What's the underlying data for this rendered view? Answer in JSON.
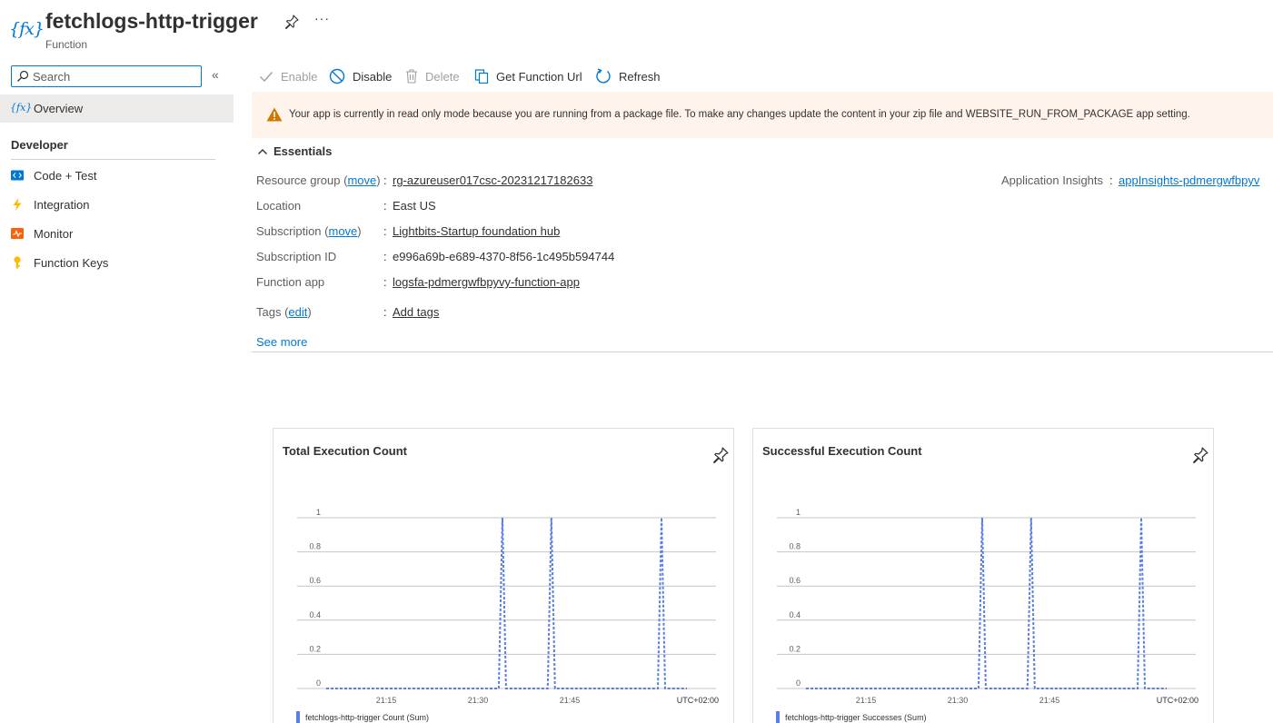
{
  "header": {
    "icon": "function-icon",
    "title": "fetchlogs-http-trigger",
    "subtitle": "Function",
    "more": "···"
  },
  "sidebar": {
    "search_placeholder": "Search",
    "collapse": "«",
    "overview": "Overview",
    "section": "Developer",
    "items": [
      {
        "label": "Code + Test",
        "icon": "code-icon"
      },
      {
        "label": "Integration",
        "icon": "lightning-icon"
      },
      {
        "label": "Monitor",
        "icon": "monitor-icon"
      },
      {
        "label": "Function Keys",
        "icon": "key-icon"
      }
    ]
  },
  "toolbar": {
    "enable": "Enable",
    "disable": "Disable",
    "delete": "Delete",
    "get_url": "Get Function Url",
    "refresh": "Refresh"
  },
  "banner": {
    "message": "Your app is currently in read only mode because you are running from a package file. To make any changes update the content in your zip file and WEBSITE_RUN_FROM_PACKAGE app setting."
  },
  "essentials": {
    "title": "Essentials",
    "resource_group_label": "Resource group (",
    "move_link": "move",
    "close_paren": ")",
    "resource_group": "rg-azureuser017csc-20231217182633",
    "location_label": "Location",
    "location": "East US",
    "subscription_label": "Subscription (",
    "subscription": "Lightbits-Startup foundation hub",
    "subscription_id_label": "Subscription ID",
    "subscription_id": "e996a69b-e689-4370-8f56-1c495b594744",
    "function_app_label": "Function app",
    "function_app": "logsfa-pdmergwfbpyvy-function-app",
    "tags_label": "Tags (",
    "edit_link": "edit",
    "add_tags": "Add tags",
    "app_insights_label": "Application Insights",
    "app_insights": "appInsights-pdmergwfbpyv",
    "colon": ":",
    "see_more": "See more"
  },
  "chart_data": [
    {
      "type": "line",
      "title": "Total Execution Count",
      "ylim": [
        0,
        1
      ],
      "yticks": [
        "1",
        "0.8",
        "0.6",
        "0.4",
        "0.2",
        "0"
      ],
      "xticks": [
        "21:15",
        "21:30",
        "21:45"
      ],
      "timezone": "UTC+02:00",
      "series": [
        {
          "name": "fetchlogs-http-trigger Count (Sum)",
          "color": "#5b7fe1",
          "spikes_at": [
            "21:34",
            "21:42",
            "22:00"
          ],
          "peak": 1,
          "base": 0
        }
      ]
    },
    {
      "type": "line",
      "title": "Successful Execution Count",
      "ylim": [
        0,
        1
      ],
      "yticks": [
        "1",
        "0.8",
        "0.6",
        "0.4",
        "0.2",
        "0"
      ],
      "xticks": [
        "21:15",
        "21:30",
        "21:45"
      ],
      "timezone": "UTC+02:00",
      "series": [
        {
          "name": "fetchlogs-http-trigger Successes (Sum)",
          "color": "#5b7fe1",
          "spikes_at": [
            "21:34",
            "21:42",
            "22:00"
          ],
          "peak": 1,
          "base": 0
        }
      ]
    }
  ]
}
